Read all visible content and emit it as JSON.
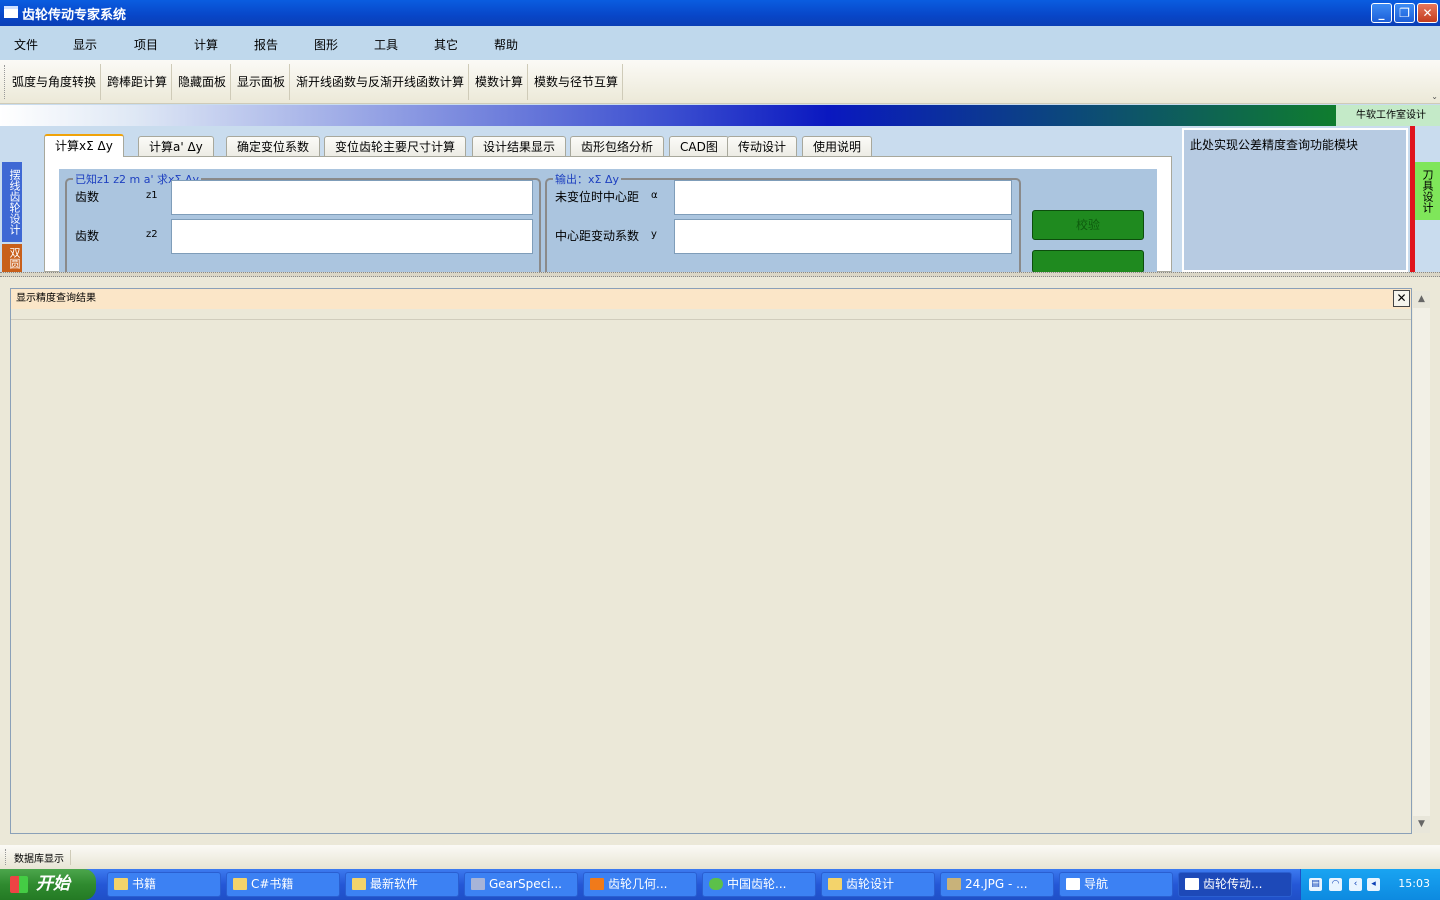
{
  "window": {
    "title": "齿轮传动专家系统",
    "minimize": "_",
    "maximize": "❐",
    "close": "✕"
  },
  "menu": [
    "文件",
    "显示",
    "项目",
    "计算",
    "报告",
    "图形",
    "工具",
    "其它",
    "帮助"
  ],
  "toolbar": [
    "弧度与角度转换",
    "跨棒距计算",
    "隐藏面板",
    "显示面板",
    "渐开线函数与反渐开线函数计算",
    "模数计算",
    "模数与径节互算"
  ],
  "studio": "牛软工作室设计",
  "left_tabs": [
    "摆线齿轮设计",
    "双圆"
  ],
  "tabs": [
    "计算xΣ Δy",
    "计算a' Δy",
    "确定变位系数",
    "变位齿轮主要尺寸计算",
    "设计结果显示",
    "齿形包络分析",
    "CAD图",
    "传动设计",
    "使用说明"
  ],
  "form": {
    "input_group": {
      "legend": "已知z1 z2 m a' 求xΣ Δy",
      "rows": [
        {
          "label": "齿数",
          "symbol": "z1",
          "value": ""
        },
        {
          "label": "齿数",
          "symbol": "z2",
          "value": ""
        }
      ]
    },
    "output_group": {
      "legend": "输出：xΣ Δy",
      "rows": [
        {
          "label": "未变位时中心距",
          "symbol": "α",
          "value": ""
        },
        {
          "label": "中心距变动系数",
          "symbol": "y",
          "value": ""
        }
      ]
    },
    "verify_button": "校验"
  },
  "right_panel": {
    "text": "此处实现公差精度查询功能模块",
    "side_tab": "刀具设计"
  },
  "results": {
    "header": "显示精度查询结果",
    "close": "✕"
  },
  "status": {
    "label": "数据库显示"
  },
  "taskbar": {
    "start": "开始",
    "tasks": [
      {
        "label": "书籍",
        "active": false
      },
      {
        "label": "C#书籍",
        "active": false
      },
      {
        "label": "最新软件",
        "active": false
      },
      {
        "label": "GearSpeci...",
        "active": false
      },
      {
        "label": "齿轮几何...",
        "active": false
      },
      {
        "label": "中国齿轮...",
        "active": false
      },
      {
        "label": "齿轮设计",
        "active": false
      },
      {
        "label": "24.JPG - ...",
        "active": false
      },
      {
        "label": "导航",
        "active": false
      },
      {
        "label": "齿轮传动...",
        "active": true
      }
    ],
    "clock": "15:03"
  }
}
